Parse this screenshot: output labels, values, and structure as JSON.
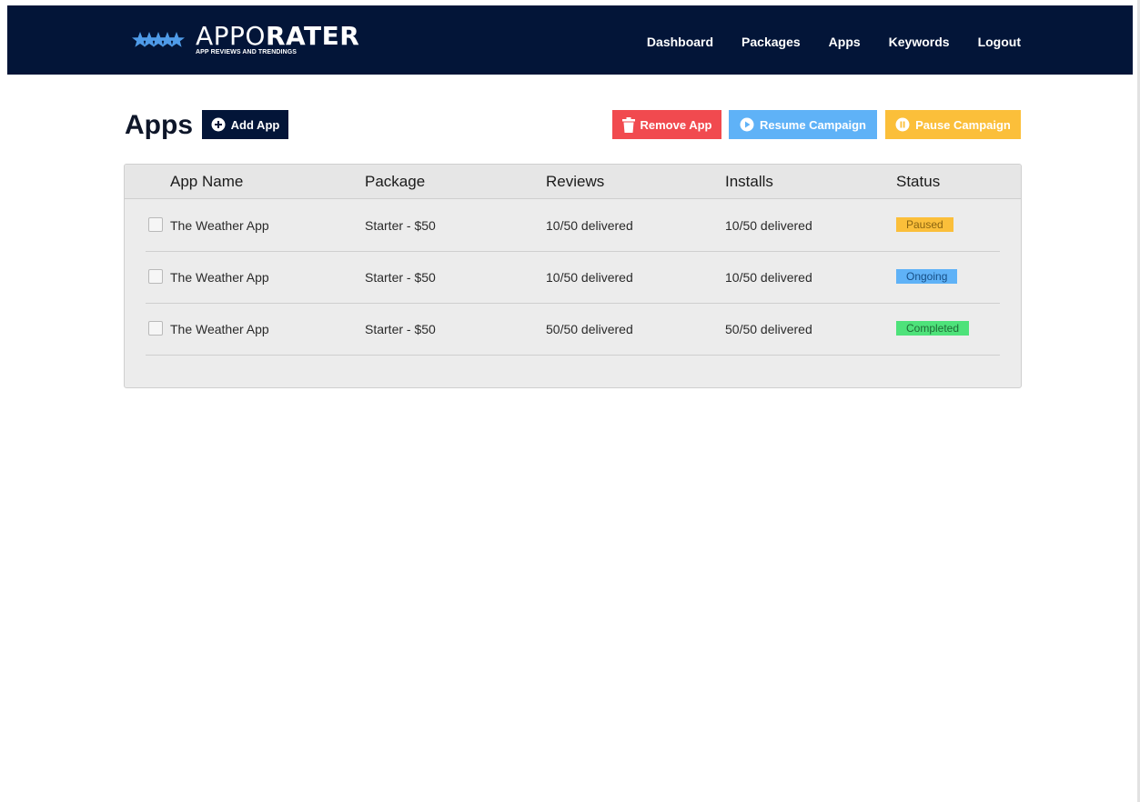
{
  "brand": {
    "name_light": "APPO",
    "name_bold": "RATER",
    "tagline": "APP REVIEWS AND TRENDINGS",
    "star_color": "#4f9be8"
  },
  "nav": {
    "items": [
      "Dashboard",
      "Packages",
      "Apps",
      "Keywords",
      "Logout"
    ]
  },
  "page": {
    "title": "Apps"
  },
  "toolbar": {
    "add_label": "Add App",
    "remove_label": "Remove App",
    "resume_label": "Resume Campaign",
    "pause_label": "Pause Campaign"
  },
  "table": {
    "headers": [
      "App Name",
      "Package",
      "Reviews",
      "Installs",
      "Status"
    ],
    "rows": [
      {
        "name": "The Weather App",
        "package": "Starter - $50",
        "reviews": "10/50 delivered",
        "installs": "10/50 delivered",
        "status": "Paused"
      },
      {
        "name": "The Weather App",
        "package": "Starter - $50",
        "reviews": "10/50 delivered",
        "installs": "10/50 delivered",
        "status": "Ongoing"
      },
      {
        "name": "The Weather App",
        "package": "Starter - $50",
        "reviews": "50/50 delivered",
        "installs": "50/50 delivered",
        "status": "Completed"
      }
    ]
  },
  "colors": {
    "header_bg": "#031538",
    "remove": "#f14a4f",
    "resume": "#5fb2f7",
    "pause": "#fbbf3a",
    "status_paused_bg": "#fbbf3a",
    "status_paused_text": "#8a6410",
    "status_ongoing_bg": "#5fb2f7",
    "status_ongoing_text": "#174f86",
    "status_completed_bg": "#4ee27a",
    "status_completed_text": "#1f6b36"
  }
}
